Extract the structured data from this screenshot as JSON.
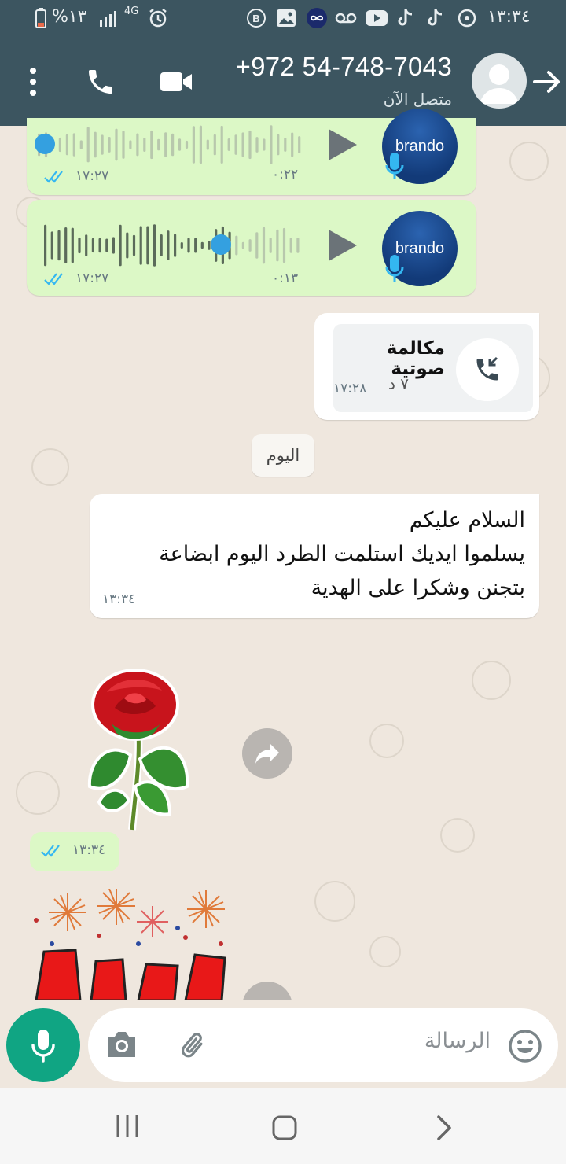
{
  "status_bar": {
    "battery": "%١٣",
    "network": "4G",
    "time": "١٣:٣٤"
  },
  "header": {
    "contact": "+972 54-748-7043",
    "presence": "متصل الآن",
    "icons": [
      "more-vert-icon",
      "phone-icon",
      "video-icon",
      "avatar",
      "back-arrow-icon"
    ]
  },
  "messages": {
    "voice1": {
      "avatar_text": "brando",
      "duration": "٠:٢٢",
      "time": "١٧:٢٧",
      "progress": 0.0
    },
    "voice2": {
      "avatar_text": "brando",
      "duration": "٠:١٣",
      "time": "١٧:٢٧",
      "progress": 0.72
    },
    "call": {
      "title": "مكالمة صوتية",
      "duration": "٧ د",
      "time": "١٧:٢٨"
    },
    "date_divider": "اليوم",
    "text_in": {
      "lines": [
        "السلام عليكم",
        "يسلموا ايديك استلمت الطرد اليوم ابضاعة",
        "بتجنن وشكرا على الهدية"
      ],
      "time": "١٣:٣٤"
    },
    "sticker_time": "١٣:٣٤"
  },
  "input": {
    "placeholder": "الرسالة"
  },
  "colors": {
    "header": "#3c5560",
    "outgoing_bubble": "#dcf8c6",
    "incoming_bubble": "#ffffff",
    "accent": "#10a583",
    "tick_blue": "#34b7f1"
  }
}
